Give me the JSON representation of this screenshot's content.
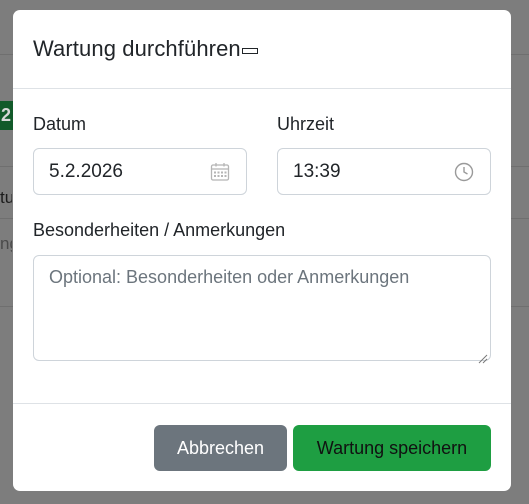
{
  "modal": {
    "title": "Wartung durchführen",
    "date_label": "Datum",
    "date_value": "5.2.2026",
    "time_label": "Uhrzeit",
    "time_value": "13:39",
    "notes_label": "Besonderheiten / Anmerkungen",
    "notes_placeholder": "Optional: Besonderheiten oder Anmerkungen",
    "cancel_label": "Abbrechen",
    "save_label": "Wartung speichern"
  },
  "background": {
    "badge_text": "2",
    "row_text_1": "tu",
    "row_text_2": "ng"
  },
  "colors": {
    "save_button": "#1e9e42",
    "cancel_button": "#6c757d"
  },
  "icons": {
    "date_field": "calendar-icon",
    "time_field": "clock-icon"
  }
}
